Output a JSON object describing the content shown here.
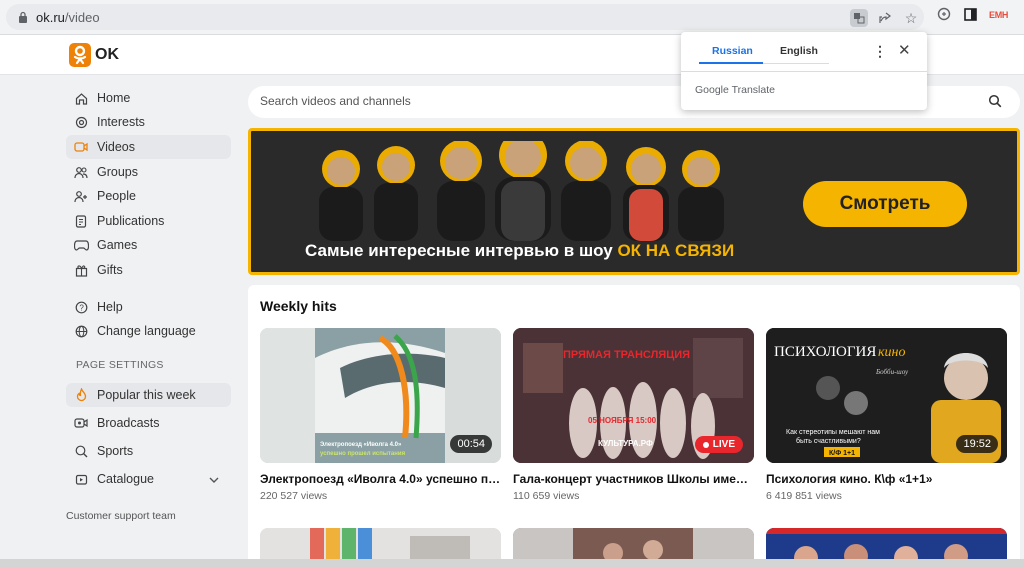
{
  "browser": {
    "url_host": "ok.ru",
    "url_path": "/video",
    "ext_label": "EMH"
  },
  "header": {
    "logo_text": "OK"
  },
  "sidebar": {
    "items": [
      {
        "label": "Home",
        "icon": "home-icon"
      },
      {
        "label": "Interests",
        "icon": "interests-icon"
      },
      {
        "label": "Videos",
        "icon": "video-icon"
      },
      {
        "label": "Groups",
        "icon": "groups-icon"
      },
      {
        "label": "People",
        "icon": "people-icon"
      },
      {
        "label": "Publications",
        "icon": "publications-icon"
      },
      {
        "label": "Games",
        "icon": "gamepad-icon"
      },
      {
        "label": "Gifts",
        "icon": "gift-icon"
      }
    ],
    "help": "Help",
    "change_language": "Change language",
    "page_settings_label": "PAGE SETTINGS",
    "settings": [
      {
        "label": "Popular this week",
        "icon": "fire-icon"
      },
      {
        "label": "Broadcasts",
        "icon": "broadcast-icon"
      },
      {
        "label": "Sports",
        "icon": "sports-icon"
      },
      {
        "label": "Catalogue",
        "icon": "catalogue-icon"
      }
    ],
    "support": "Customer support team"
  },
  "search": {
    "placeholder": "Search videos and channels"
  },
  "banner": {
    "text_main": "Самые интересные интервью в шоу ",
    "text_highlight": "ОК НА СВЯЗИ",
    "button": "Смотреть"
  },
  "weekly_hits": {
    "title": "Weekly hits",
    "videos": [
      {
        "title": "Электропоезд «Иволга 4.0» успешно пр...",
        "views": "220 527 views",
        "duration": "00:54",
        "thumb_color": "#b8c4c2",
        "thumb_caption": "Электропоезд «Иволга 4.0» успешно прошел испытания"
      },
      {
        "title": "Гала-концерт участников Школы имени...",
        "views": "110 659 views",
        "badge": "LIVE",
        "thumb_color": "#3a2a2e",
        "thumb_caption_top": "ПРЯМАЯ ТРАНСЛЯЦИЯ",
        "thumb_caption_date": "05 НОЯБРЯ 15:00",
        "thumb_caption_channel": "КУЛЬТУРА.РФ"
      },
      {
        "title": "Психология кино. К\\ф «1+1»",
        "views": "6 419 851 views",
        "duration": "19:52",
        "thumb_color": "#1e1e1e",
        "thumb_caption_top": "ПСИХОЛОГИЯ кино",
        "thumb_caption_sub": "Как стереотипы мешают нам быть счастливыми?",
        "thumb_caption_tag": "К/Ф 1+1"
      }
    ]
  },
  "translate_popup": {
    "tab_active": "Russian",
    "tab_inactive": "English",
    "brand_google": "Google",
    "brand_translate": " Translate"
  }
}
